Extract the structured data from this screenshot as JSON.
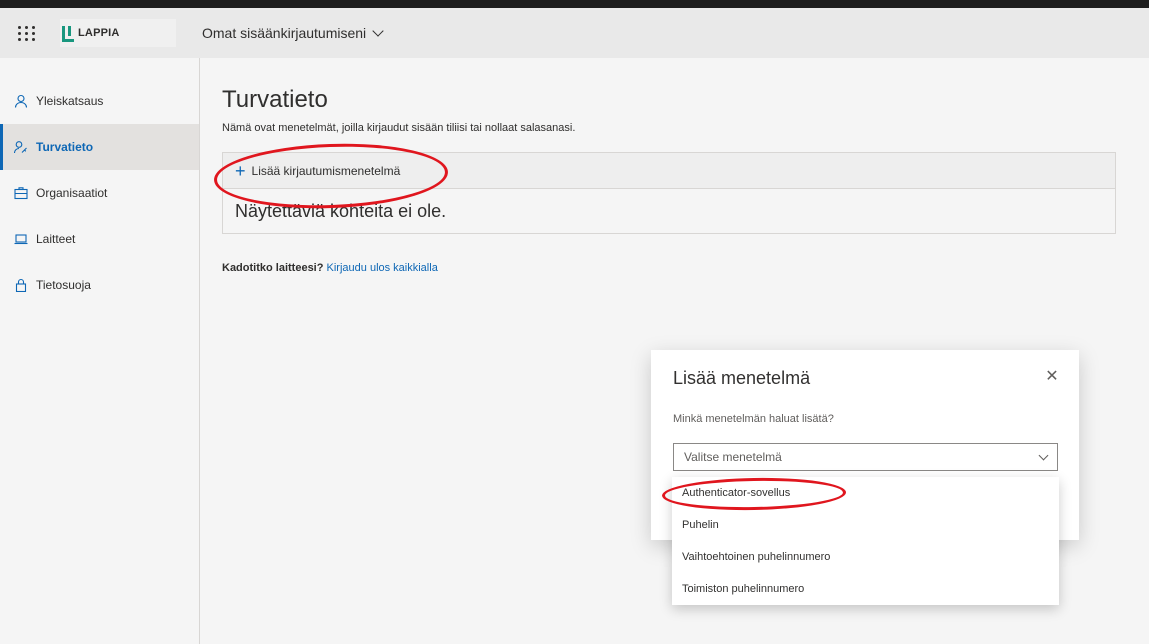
{
  "topbar": {
    "logo_text": "LAPPIA",
    "app_title": "Omat sisäänkirjautumiseni"
  },
  "sidebar": {
    "items": [
      {
        "label": "Yleiskatsaus",
        "icon": "person-icon"
      },
      {
        "label": "Turvatieto",
        "icon": "key-person-icon",
        "active": true
      },
      {
        "label": "Organisaatiot",
        "icon": "briefcase-icon"
      },
      {
        "label": "Laitteet",
        "icon": "laptop-icon"
      },
      {
        "label": "Tietosuoja",
        "icon": "lock-icon"
      }
    ]
  },
  "main": {
    "title": "Turvatieto",
    "subtitle": "Nämä ovat menetelmät, joilla kirjaudut sisään tiliisi tai nollaat salasanasi.",
    "add_method_label": "Lisää kirjautumismenetelmä",
    "empty_text": "Näytettäviä kohteita ei ole.",
    "lost_question": "Kadotitko laitteesi?",
    "lost_link": "Kirjaudu ulos kaikkialla"
  },
  "modal": {
    "title": "Lisää menetelmä",
    "question": "Minkä menetelmän haluat lisätä?",
    "select_placeholder": "Valitse menetelmä",
    "options": [
      "Authenticator-sovellus",
      "Puhelin",
      "Vaihtoehtoinen puhelinnumero",
      "Toimiston puhelinnumero"
    ]
  },
  "colors": {
    "accent": "#0f6cbd",
    "annotation": "#e0161e"
  }
}
